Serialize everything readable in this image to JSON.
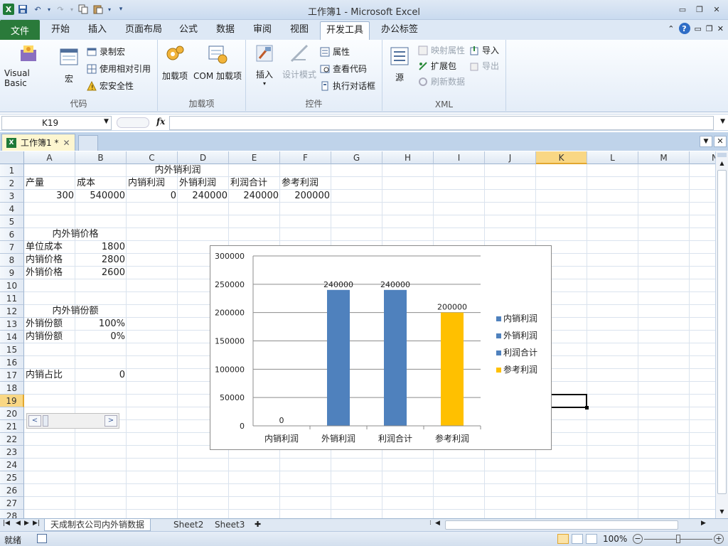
{
  "window": {
    "title": "工作簿1 - Microsoft Excel"
  },
  "ribbon_tabs": [
    {
      "label": "文件"
    },
    {
      "label": "开始"
    },
    {
      "label": "插入"
    },
    {
      "label": "页面布局"
    },
    {
      "label": "公式"
    },
    {
      "label": "数据"
    },
    {
      "label": "审阅"
    },
    {
      "label": "视图"
    },
    {
      "label": "开发工具"
    },
    {
      "label": "办公标签"
    }
  ],
  "ribbon": {
    "code_group": {
      "label": "代码",
      "visual_basic": "Visual Basic",
      "macro": "宏",
      "record_macro": "录制宏",
      "relative_ref": "使用相对引用",
      "macro_security": "宏安全性"
    },
    "addins_group": {
      "label": "加载项",
      "addins": "加载项",
      "com_addins": "COM 加载项"
    },
    "controls_group": {
      "label": "控件",
      "insert": "插入",
      "design_mode": "设计模式",
      "properties": "属性",
      "view_code": "查看代码",
      "run_dialog": "执行对话框"
    },
    "xml_group": {
      "label": "XML",
      "source": "源",
      "map_props": "映射属性",
      "expansion_packs": "扩展包",
      "refresh_data": "刷新数据",
      "import": "导入",
      "export": "导出"
    }
  },
  "formula_bar": {
    "name_box": "K19",
    "fx": "fx",
    "formula": ""
  },
  "workbook_tab": {
    "label": "工作簿1 *"
  },
  "columns": [
    "A",
    "B",
    "C",
    "D",
    "E",
    "F",
    "G",
    "H",
    "I",
    "J",
    "K",
    "L",
    "M",
    "N"
  ],
  "rows": [
    "1",
    "2",
    "3",
    "4",
    "5",
    "6",
    "7",
    "8",
    "9",
    "10",
    "11",
    "12",
    "13",
    "14",
    "15",
    "16",
    "17",
    "18",
    "19",
    "20",
    "21",
    "22",
    "23",
    "24",
    "25",
    "26",
    "27",
    "28"
  ],
  "cells": {
    "C1": "内外销利润",
    "A2": "产量",
    "B2": "成本",
    "C2": "内销利润",
    "D2": "外销利润",
    "E2": "利润合计",
    "F2": "参考利润",
    "A3": "300",
    "B3": "540000",
    "C3": "0",
    "D3": "240000",
    "E3": "240000",
    "F3": "200000",
    "A6": "内外销价格",
    "A7": "单位成本",
    "B7": "1800",
    "A8": "内销价格",
    "B8": "2800",
    "A9": "外销价格",
    "B9": "2600",
    "A12": "内外销份额",
    "A13": "外销份额",
    "B13": "100%",
    "A14": "内销份额",
    "B14": "0%",
    "A17": "内销占比",
    "B17": "0"
  },
  "chart_data": {
    "type": "bar",
    "categories": [
      "内销利润",
      "外销利润",
      "利润合计",
      "参考利润"
    ],
    "values": [
      0,
      240000,
      240000,
      200000
    ],
    "data_labels": [
      "0",
      "240000",
      "240000",
      "200000"
    ],
    "colors": [
      "#4f81bd",
      "#4f81bd",
      "#4f81bd",
      "#ffc000"
    ],
    "ylim": [
      0,
      300000
    ],
    "yticks": [
      "300000",
      "250000",
      "200000",
      "150000",
      "100000",
      "50000",
      "0"
    ],
    "grid": true,
    "legend": "right",
    "legend_entries": [
      {
        "name": "内销利润",
        "color": "#4f81bd"
      },
      {
        "name": "外销利润",
        "color": "#4f81bd"
      },
      {
        "name": "利润合计",
        "color": "#4f81bd"
      },
      {
        "name": "参考利润",
        "color": "#ffc000"
      }
    ]
  },
  "sheet_tabs": [
    {
      "label": "天成制衣公司内外销数据"
    },
    {
      "label": "Sheet2"
    },
    {
      "label": "Sheet3"
    }
  ],
  "status": {
    "ready": "就绪",
    "zoom": "100%"
  }
}
